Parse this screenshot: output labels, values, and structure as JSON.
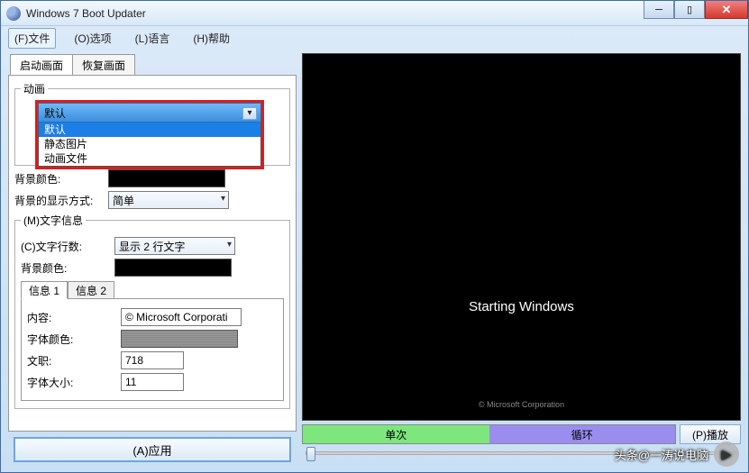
{
  "window": {
    "title": "Windows 7 Boot Updater"
  },
  "menu": {
    "file": "(F)文件",
    "options": "(O)选项",
    "language": "(L)语言",
    "help": "(H)帮助"
  },
  "tabs": {
    "boot": "启动画面",
    "recovery": "恢复画面"
  },
  "fieldset": {
    "animation": "动画",
    "textinfo": "(M)文字信息"
  },
  "dropdown": {
    "selected": "默认",
    "opt1": "默认",
    "opt2": "静态图片",
    "opt3": "动画文件"
  },
  "labels": {
    "bgcolor": "背景颜色:",
    "bgmode": "背景的显示方式:",
    "textlines": "(C)文字行数:",
    "bgcolor2": "背景颜色:",
    "content": "内容:",
    "fontcolor": "字体颜色:",
    "position": "文职:",
    "fontsize": "字体大小:"
  },
  "values": {
    "bgmode": "简单",
    "textlines": "显示 2 行文字",
    "content": "© Microsoft Corporati",
    "position": "718",
    "fontsize": "11"
  },
  "inner_tabs": {
    "info1": "信息 1",
    "info2": "信息 2"
  },
  "apply": "(A)应用",
  "preview": {
    "starting": "Starting Windows",
    "copyright": "© Microsoft Corporation"
  },
  "controls": {
    "once": "单次",
    "loop": "循环",
    "play": "(P)播放"
  },
  "watermark": "头条@一涛说电脑"
}
